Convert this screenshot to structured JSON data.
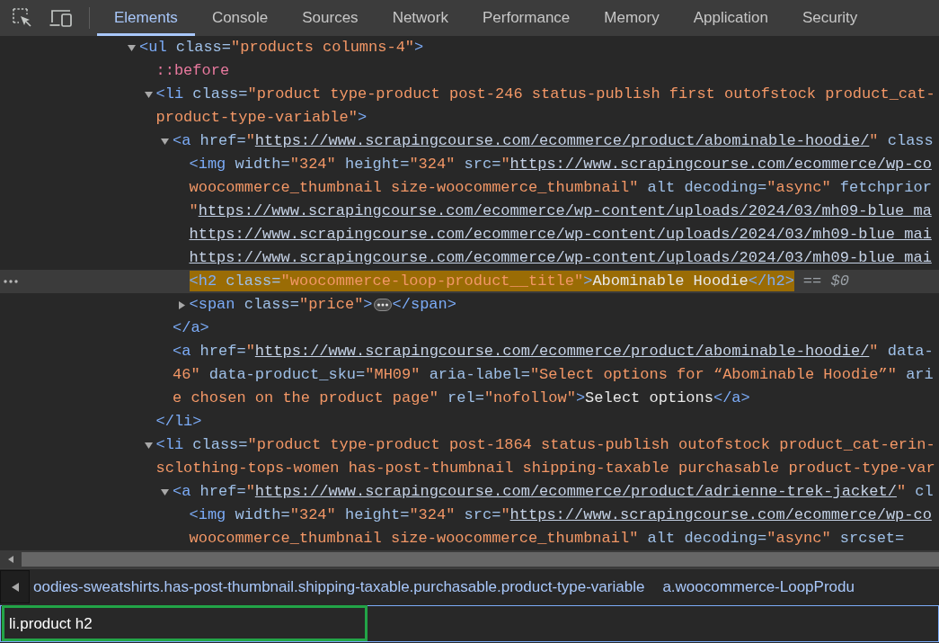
{
  "tabs": [
    {
      "label": "Elements",
      "selected": true
    },
    {
      "label": "Console",
      "selected": false
    },
    {
      "label": "Sources",
      "selected": false
    },
    {
      "label": "Network",
      "selected": false
    },
    {
      "label": "Performance",
      "selected": false
    },
    {
      "label": "Memory",
      "selected": false
    },
    {
      "label": "Application",
      "selected": false
    },
    {
      "label": "Security",
      "selected": false
    }
  ],
  "dom_tree": [
    {
      "kind": "container",
      "expanded": true,
      "selected": false,
      "search_match": false,
      "lines": [
        [
          {
            "kind": "tag",
            "text": "<ul"
          },
          {
            "kind": "attr",
            "text": " class="
          },
          {
            "kind": "value",
            "text": "\"products columns-4\""
          },
          {
            "kind": "tag",
            "text": ">"
          }
        ]
      ],
      "children": [
        {
          "kind": "leaf",
          "selected": false,
          "search_match": false,
          "lines": [
            [
              {
                "kind": "pseudo",
                "text": "::before"
              }
            ]
          ]
        },
        {
          "kind": "container",
          "expanded": true,
          "selected": false,
          "search_match": false,
          "lines": [
            [
              {
                "kind": "tag",
                "text": "<li"
              },
              {
                "kind": "attr",
                "text": " class="
              },
              {
                "kind": "value",
                "text": "\"product type-product post-246 status-publish first outofstock product_cat-"
              }
            ],
            [
              {
                "kind": "value",
                "text": "product-type-variable\""
              },
              {
                "kind": "tag",
                "text": ">"
              }
            ]
          ],
          "children": [
            {
              "kind": "container",
              "expanded": true,
              "selected": false,
              "search_match": false,
              "lines": [
                [
                  {
                    "kind": "tag",
                    "text": "<a"
                  },
                  {
                    "kind": "attr",
                    "text": " href="
                  },
                  {
                    "kind": "value",
                    "text": "\""
                  },
                  {
                    "kind": "link",
                    "text": "https://www.scrapingcourse.com/ecommerce/product/abominable-hoodie/"
                  },
                  {
                    "kind": "value",
                    "text": "\""
                  },
                  {
                    "kind": "attr",
                    "text": " class"
                  }
                ]
              ],
              "children": [
                {
                  "kind": "leaf",
                  "selected": false,
                  "search_match": false,
                  "lines": [
                    [
                      {
                        "kind": "tag",
                        "text": "<img"
                      },
                      {
                        "kind": "attr",
                        "text": " width="
                      },
                      {
                        "kind": "value",
                        "text": "\"324\""
                      },
                      {
                        "kind": "attr",
                        "text": " height="
                      },
                      {
                        "kind": "value",
                        "text": "\"324\""
                      },
                      {
                        "kind": "attr",
                        "text": " src="
                      },
                      {
                        "kind": "value",
                        "text": "\""
                      },
                      {
                        "kind": "link",
                        "text": "https://www.scrapingcourse.com/ecommerce/wp-co"
                      }
                    ],
                    [
                      {
                        "kind": "value",
                        "text": "woocommerce_thumbnail size-woocommerce_thumbnail\""
                      },
                      {
                        "kind": "attr",
                        "text": " alt"
                      },
                      {
                        "kind": "attr",
                        "text": " decoding="
                      },
                      {
                        "kind": "value",
                        "text": "\"async\""
                      },
                      {
                        "kind": "attr",
                        "text": " fetchprior"
                      }
                    ],
                    [
                      {
                        "kind": "value",
                        "text": "\""
                      },
                      {
                        "kind": "link",
                        "text": "https://www.scrapingcourse.com/ecommerce/wp-content/uploads/2024/03/mh09-blue_ma"
                      }
                    ],
                    [
                      {
                        "kind": "link",
                        "text": "https://www.scrapingcourse.com/ecommerce/wp-content/uploads/2024/03/mh09-blue_mai"
                      }
                    ],
                    [
                      {
                        "kind": "link",
                        "text": "https://www.scrapingcourse.com/ecommerce/wp-content/uploads/2024/03/mh09-blue_mai"
                      }
                    ]
                  ]
                },
                {
                  "kind": "leaf",
                  "selected": true,
                  "search_match": true,
                  "console_ref": "== *$0*",
                  "lines": [
                    [
                      {
                        "kind": "tag",
                        "text": "<h2"
                      },
                      {
                        "kind": "attr",
                        "text": " class="
                      },
                      {
                        "kind": "value",
                        "text": "\"woocommerce-loop-product__title\""
                      },
                      {
                        "kind": "tag",
                        "text": ">"
                      },
                      {
                        "kind": "text",
                        "text": "Abominable Hoodie"
                      },
                      {
                        "kind": "tag",
                        "text": "</h2>"
                      }
                    ]
                  ]
                },
                {
                  "kind": "container",
                  "expanded": false,
                  "selected": false,
                  "search_match": false,
                  "lines": [
                    [
                      {
                        "kind": "tag",
                        "text": "<span"
                      },
                      {
                        "kind": "attr",
                        "text": " class="
                      },
                      {
                        "kind": "value",
                        "text": "\"price\""
                      },
                      {
                        "kind": "tag",
                        "text": ">"
                      },
                      {
                        "kind": "ellipsis"
                      },
                      {
                        "kind": "tag",
                        "text": "</span>"
                      }
                    ]
                  ]
                }
              ],
              "closing": [
                {
                  "kind": "tag",
                  "text": "</a>"
                }
              ]
            },
            {
              "kind": "leaf",
              "selected": false,
              "search_match": false,
              "lines": [
                [
                  {
                    "kind": "tag",
                    "text": "<a"
                  },
                  {
                    "kind": "attr",
                    "text": " href="
                  },
                  {
                    "kind": "value",
                    "text": "\""
                  },
                  {
                    "kind": "link",
                    "text": "https://www.scrapingcourse.com/ecommerce/product/abominable-hoodie/"
                  },
                  {
                    "kind": "value",
                    "text": "\""
                  },
                  {
                    "kind": "attr",
                    "text": " data-"
                  }
                ],
                [
                  {
                    "kind": "value",
                    "text": "46\""
                  },
                  {
                    "kind": "attr",
                    "text": " data-product_sku="
                  },
                  {
                    "kind": "value",
                    "text": "\"MH09\""
                  },
                  {
                    "kind": "attr",
                    "text": " aria-label="
                  },
                  {
                    "kind": "value",
                    "text": "\"Select options for “Abominable Hoodie”\""
                  },
                  {
                    "kind": "attr",
                    "text": " ari"
                  }
                ],
                [
                  {
                    "kind": "value",
                    "text": "e chosen on the product page\""
                  },
                  {
                    "kind": "attr",
                    "text": " rel="
                  },
                  {
                    "kind": "value",
                    "text": "\"nofollow\""
                  },
                  {
                    "kind": "tag",
                    "text": ">"
                  },
                  {
                    "kind": "text",
                    "text": "Select options"
                  },
                  {
                    "kind": "tag",
                    "text": "</a>"
                  }
                ]
              ]
            }
          ],
          "closing": [
            {
              "kind": "tag",
              "text": "</li>"
            }
          ]
        },
        {
          "kind": "container",
          "expanded": true,
          "selected": false,
          "search_match": false,
          "lines": [
            [
              {
                "kind": "tag",
                "text": "<li"
              },
              {
                "kind": "attr",
                "text": " class="
              },
              {
                "kind": "value",
                "text": "\"product type-product post-1864 status-publish outofstock product_cat-erin-"
              }
            ],
            [
              {
                "kind": "value",
                "text": "sclothing-tops-women has-post-thumbnail shipping-taxable purchasable product-type-var"
              }
            ]
          ],
          "children": [
            {
              "kind": "container",
              "expanded": true,
              "selected": false,
              "search_match": false,
              "lines": [
                [
                  {
                    "kind": "tag",
                    "text": "<a"
                  },
                  {
                    "kind": "attr",
                    "text": " href="
                  },
                  {
                    "kind": "value",
                    "text": "\""
                  },
                  {
                    "kind": "link",
                    "text": "https://www.scrapingcourse.com/ecommerce/product/adrienne-trek-jacket/"
                  },
                  {
                    "kind": "value",
                    "text": "\""
                  },
                  {
                    "kind": "attr",
                    "text": " cl"
                  }
                ]
              ],
              "children": [
                {
                  "kind": "leaf",
                  "selected": false,
                  "search_match": false,
                  "lines": [
                    [
                      {
                        "kind": "tag",
                        "text": "<img"
                      },
                      {
                        "kind": "attr",
                        "text": " width="
                      },
                      {
                        "kind": "value",
                        "text": "\"324\""
                      },
                      {
                        "kind": "attr",
                        "text": " height="
                      },
                      {
                        "kind": "value",
                        "text": "\"324\""
                      },
                      {
                        "kind": "attr",
                        "text": " src="
                      },
                      {
                        "kind": "value",
                        "text": "\""
                      },
                      {
                        "kind": "link",
                        "text": "https://www.scrapingcourse.com/ecommerce/wp-co"
                      }
                    ],
                    [
                      {
                        "kind": "value",
                        "text": "woocommerce_thumbnail size-woocommerce_thumbnail\""
                      },
                      {
                        "kind": "attr",
                        "text": " alt"
                      },
                      {
                        "kind": "attr",
                        "text": " decoding="
                      },
                      {
                        "kind": "value",
                        "text": "\"async\""
                      },
                      {
                        "kind": "attr",
                        "text": " srcset="
                      }
                    ]
                  ]
                }
              ]
            }
          ]
        }
      ]
    }
  ],
  "breadcrumbs": [
    {
      "label": "oodies-sweatshirts.has-post-thumbnail.shipping-taxable.purchasable.product-type-variable"
    },
    {
      "label": "a.woocommerce-LoopProdu"
    }
  ],
  "search": {
    "value": "li.product h2"
  }
}
